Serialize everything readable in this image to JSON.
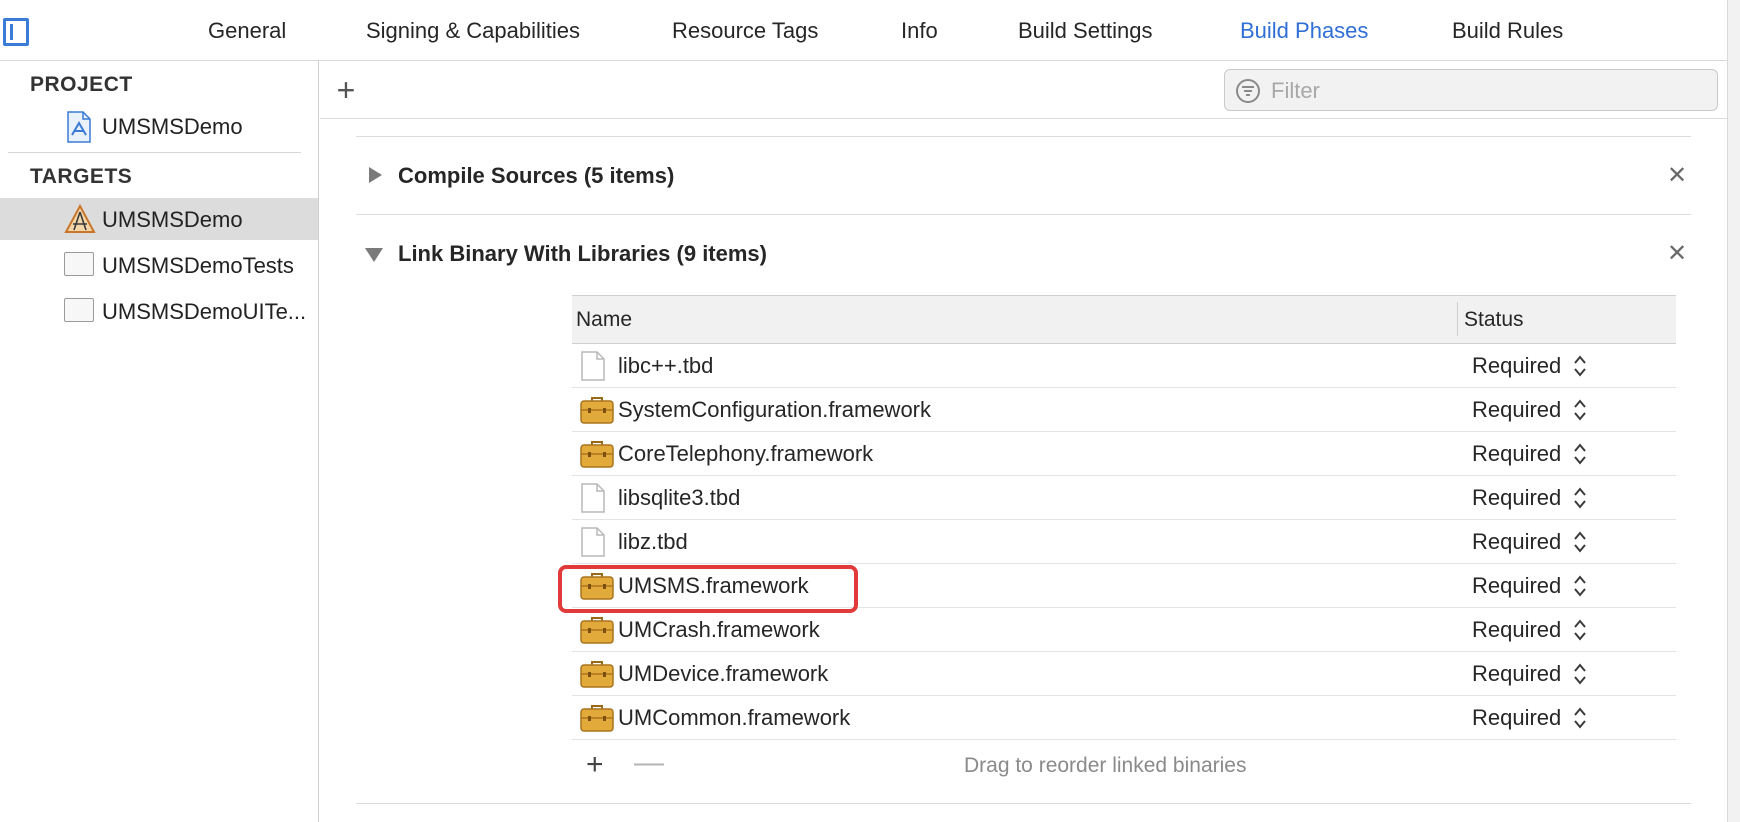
{
  "tabs": [
    {
      "label": "General",
      "active": false
    },
    {
      "label": "Signing & Capabilities",
      "active": false
    },
    {
      "label": "Resource Tags",
      "active": false
    },
    {
      "label": "Info",
      "active": false
    },
    {
      "label": "Build Settings",
      "active": false
    },
    {
      "label": "Build Phases",
      "active": true
    },
    {
      "label": "Build Rules",
      "active": false
    }
  ],
  "navigator": {
    "project_header": "PROJECT",
    "project_item": "UMSMSDemo",
    "targets_header": "TARGETS",
    "targets": [
      {
        "label": "UMSMSDemo",
        "selected": true,
        "icon": "app-target-icon"
      },
      {
        "label": "UMSMSDemoTests",
        "selected": false,
        "icon": "test-target-icon"
      },
      {
        "label": "UMSMSDemoUITe...",
        "selected": false,
        "icon": "uitest-target-icon"
      }
    ]
  },
  "toolbar": {
    "add_symbol": "+",
    "filter_placeholder": "Filter"
  },
  "phases": {
    "compile_sources": {
      "title": "Compile Sources (5 items)",
      "expanded": false
    },
    "link_binary": {
      "title": "Link Binary With Libraries (9 items)",
      "expanded": true
    }
  },
  "close_symbol": "✕",
  "table": {
    "header_name": "Name",
    "header_status": "Status",
    "rows": [
      {
        "name": "libc++.tbd",
        "status": "Required",
        "kind": "file-icon"
      },
      {
        "name": "SystemConfiguration.framework",
        "status": "Required",
        "kind": "framework-icon"
      },
      {
        "name": "CoreTelephony.framework",
        "status": "Required",
        "kind": "framework-icon"
      },
      {
        "name": "libsqlite3.tbd",
        "status": "Required",
        "kind": "file-icon"
      },
      {
        "name": "libz.tbd",
        "status": "Required",
        "kind": "file-icon"
      },
      {
        "name": "UMSMS.framework",
        "status": "Required",
        "kind": "framework-icon",
        "highlighted": true
      },
      {
        "name": "UMCrash.framework",
        "status": "Required",
        "kind": "framework-icon"
      },
      {
        "name": "UMDevice.framework",
        "status": "Required",
        "kind": "framework-icon"
      },
      {
        "name": "UMCommon.framework",
        "status": "Required",
        "kind": "framework-icon"
      }
    ],
    "footer": {
      "add_symbol": "+",
      "remove_symbol": "—",
      "hint": "Drag to reorder linked binaries"
    }
  },
  "colors": {
    "accent": "#2f6fd6",
    "highlight": "#e03a3a",
    "framework_icon": "#e2a93b"
  }
}
